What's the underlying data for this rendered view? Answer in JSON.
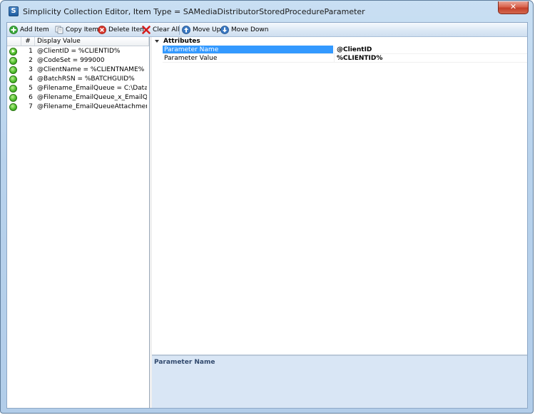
{
  "window": {
    "title": "Simplicity Collection Editor, Item Type = SAMediaDistributorStoredProcedureParameter",
    "app_icon_letter": "S",
    "close_glyph": "✕"
  },
  "toolbar": {
    "add_label": "Add Item",
    "copy_label": "Copy Item",
    "delete_label": "Delete Item",
    "clear_label": "Clear All",
    "move_up_label": "Move Up",
    "move_down_label": "Move Down"
  },
  "grid": {
    "headers": {
      "number": "#",
      "display_value": "Display Value"
    },
    "rows": [
      {
        "num": "1",
        "value": "@ClientID = %CLIENTID%"
      },
      {
        "num": "2",
        "value": "@CodeSet = 999000"
      },
      {
        "num": "3",
        "value": "@ClientName = %CLIENTNAME%"
      },
      {
        "num": "4",
        "value": "@BatchRSN = %BATCHGUID%"
      },
      {
        "num": "5",
        "value": "@Filename_EmailQueue = C:\\Data\\U..."
      },
      {
        "num": "6",
        "value": "@Filename_EmailQueue_x_EmailQue..."
      },
      {
        "num": "7",
        "value": "@Filename_EmailQueueAttachment =..."
      }
    ]
  },
  "properties": {
    "category": "Attributes",
    "rows": [
      {
        "name": "Parameter Name",
        "value": "@ClientID"
      },
      {
        "name": "Parameter Value",
        "value": "%CLIENTID%"
      }
    ]
  },
  "description": {
    "title": "Parameter Name"
  },
  "colors": {
    "selection": "#3399ff",
    "status_green": "#4fbd2c",
    "delete_red": "#d8352a",
    "toolbar_blue": "#3b79c2"
  },
  "icons": [
    "add-icon",
    "copy-icon",
    "delete-icon",
    "clear-all-icon",
    "move-up-icon",
    "move-down-icon",
    "close-icon"
  ]
}
